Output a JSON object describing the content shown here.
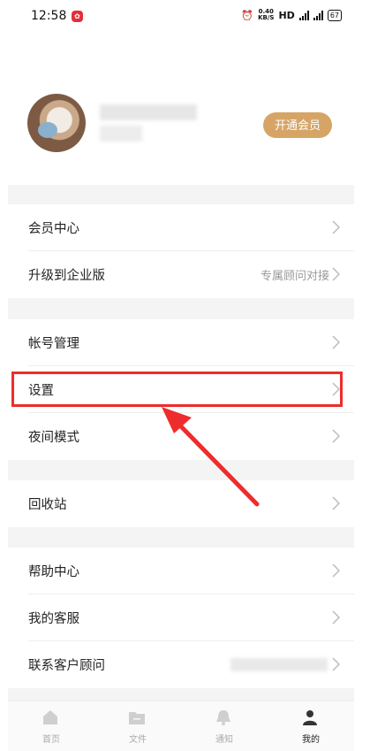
{
  "status_bar": {
    "time": "12:58",
    "app_icon": "notification-app-icon",
    "net_speed_value": "0.40",
    "net_speed_unit": "KB/S",
    "hd": "HD",
    "battery": "67"
  },
  "profile": {
    "vip_button": "开通会员"
  },
  "menu": {
    "vip_center": "会员中心",
    "upgrade": "升级到企业版",
    "upgrade_value": "专属顾问对接",
    "account": "帐号管理",
    "settings": "设置",
    "night_mode": "夜间模式",
    "recycle": "回收站",
    "help": "帮助中心",
    "service": "我的客服",
    "contact": "联系客户顾问"
  },
  "nav": {
    "home": "首页",
    "files": "文件",
    "notify": "通知",
    "mine": "我的"
  },
  "colors": {
    "accent_gold": "#d6a566",
    "highlight_red": "#ee2c2c"
  }
}
